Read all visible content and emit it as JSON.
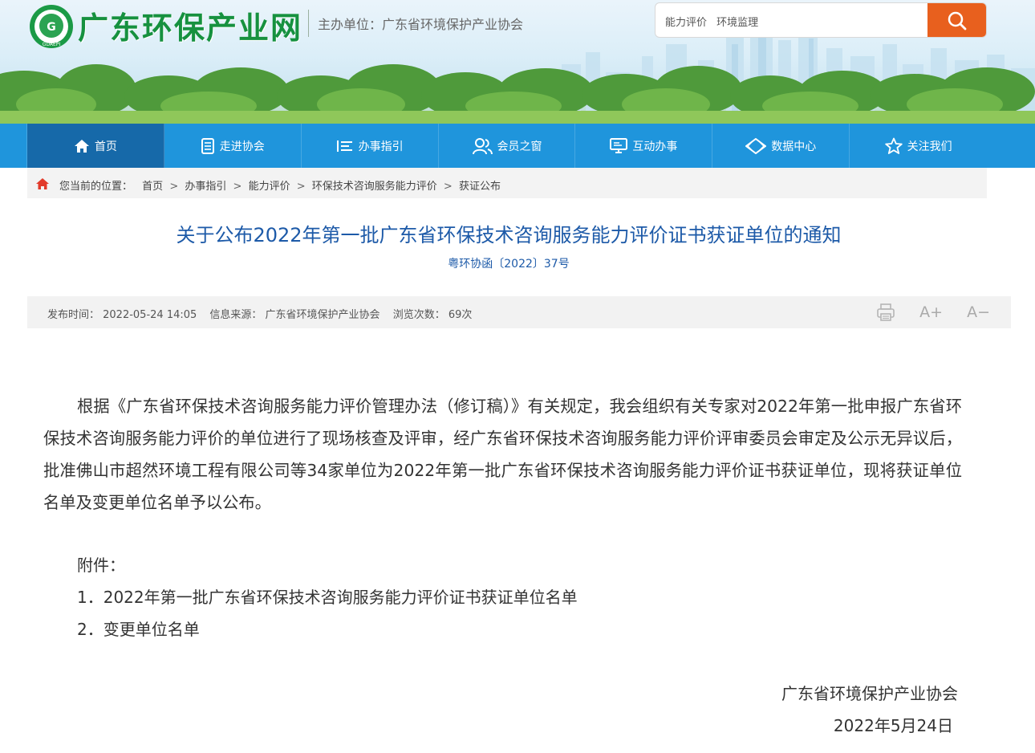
{
  "header": {
    "site_title": "广东环保产业网",
    "logo_text": "GDAEPI",
    "organizer": "主办单位：广东省环境保护产业协会",
    "search_hints": [
      "能力评价",
      "环境监理"
    ]
  },
  "nav": {
    "items": [
      {
        "label": "首页",
        "icon": "home-icon"
      },
      {
        "label": "走进协会",
        "icon": "document-icon"
      },
      {
        "label": "办事指引",
        "icon": "list-icon"
      },
      {
        "label": "会员之窗",
        "icon": "users-icon"
      },
      {
        "label": "互动办事",
        "icon": "monitor-icon"
      },
      {
        "label": "数据中心",
        "icon": "diamond-icon"
      },
      {
        "label": "关注我们",
        "icon": "star-icon"
      }
    ]
  },
  "breadcrumb": {
    "prefix": "您当前的位置：",
    "items": [
      "首页",
      "办事指引",
      "能力评价",
      "环保技术咨询服务能力评价",
      "获证公布"
    ]
  },
  "article": {
    "title": "关于公布2022年第一批广东省环保技术咨询服务能力评价证书获证单位的通知",
    "doc_no": "粤环协函〔2022〕37号",
    "meta": {
      "publish_time": "发布时间：  2022-05-24 14:05",
      "source": "信息来源：  广东省环境保护产业协会",
      "views": "浏览次数：  69次"
    },
    "tools": {
      "font_increase": "A+",
      "font_decrease": "A−"
    },
    "body": "根据《广东省环保技术咨询服务能力评价管理办法（修订稿）》有关规定，我会组织有关专家对2022年第一批申报广东省环保技术咨询服务能力评价的单位进行了现场核查及评审，经广东省环保技术咨询服务能力评价评审委员会审定及公示无异议后，批准佛山市超然环境工程有限公司等34家单位为2022年第一批广东省环保技术咨询服务能力评价证书获证单位，现将获证单位名单及变更单位名单予以公布。",
    "attachment_label": "附件：",
    "attachments": [
      "1．2022年第一批广东省环保技术咨询服务能力评价证书获证单位名单",
      "2．变更单位名单"
    ],
    "signature": "广东省环境保护产业协会",
    "date": "2022年5月24日"
  },
  "colors": {
    "brand_green": "#16913f",
    "nav_blue": "#1f95dc",
    "nav_active": "#1669a9",
    "search_orange": "#e8601e",
    "title_blue": "#1d5aa8"
  }
}
